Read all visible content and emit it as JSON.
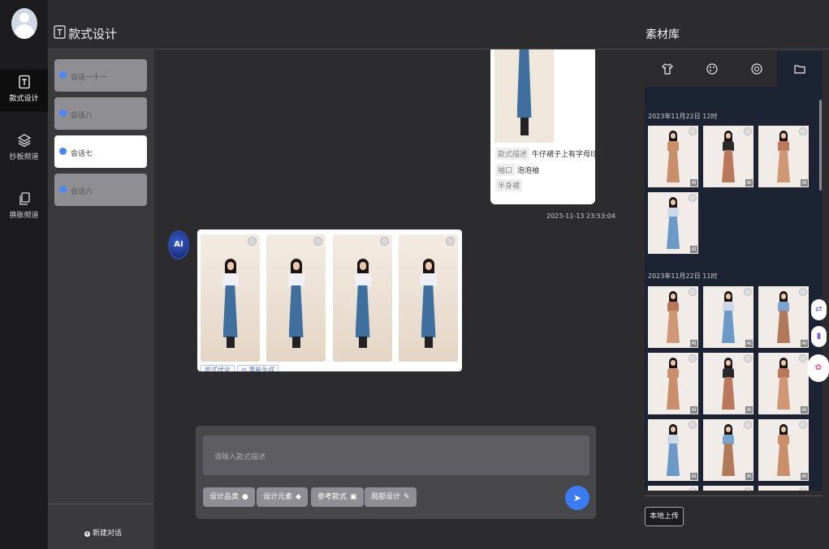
{
  "rail": {
    "items": [
      {
        "label": "款式设计"
      },
      {
        "label": "抄板频道"
      },
      {
        "label": "换胀频道"
      }
    ]
  },
  "header": {
    "title": "款式设计"
  },
  "sessions": {
    "items": [
      {
        "label": "会话一十一"
      },
      {
        "label": "会话八"
      },
      {
        "label": "会话七"
      },
      {
        "label": "会话六"
      }
    ],
    "new_chat": "新建对话"
  },
  "chat": {
    "user_message": {
      "tags": [
        {
          "tag": "款式描述",
          "value": "牛仔裙子上有字母印花"
        },
        {
          "tag": "袖口",
          "value": "泡泡袖"
        },
        {
          "tag": "半身裙",
          "value": ""
        }
      ],
      "time": "2023-11-13 23:53:04"
    },
    "ai_message": {
      "avatar_label": "AI",
      "actions": [
        "款式优化",
        "⟲ 重新生成"
      ]
    }
  },
  "input": {
    "placeholder": "请输入款式描述",
    "chips": [
      {
        "label": "设计品类",
        "icon": "●"
      },
      {
        "label": "设计元素",
        "icon": "◆"
      },
      {
        "label": "参考款式",
        "icon": "▣"
      },
      {
        "label": "局部设计",
        "icon": "✎"
      }
    ],
    "send_icon": "➤"
  },
  "library": {
    "title": "素材库",
    "tabs": [
      "shirt-icon",
      "palette-icon",
      "pattern-icon",
      "folder-icon"
    ],
    "groups": [
      {
        "date": "2023年11月22日 12时",
        "count": 4
      },
      {
        "date": "2023年11月22日 11时",
        "count": 9
      }
    ],
    "badge": "AI",
    "upload_label": "本地上传"
  }
}
